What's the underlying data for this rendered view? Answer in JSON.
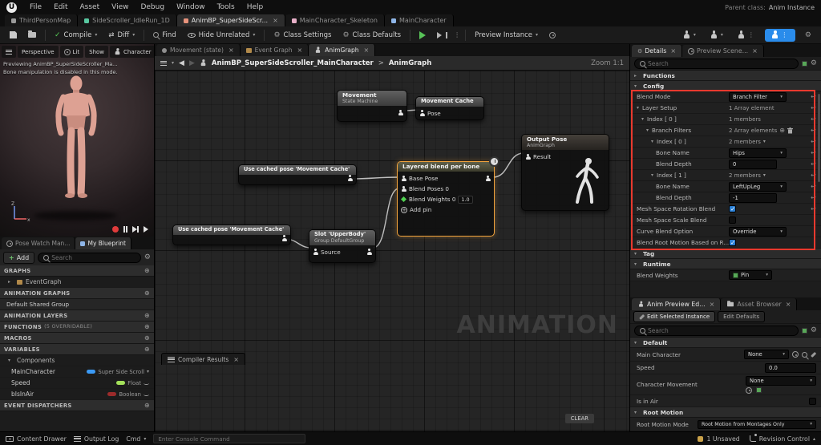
{
  "menubar": {
    "items": [
      "File",
      "Edit",
      "Asset",
      "View",
      "Debug",
      "Window",
      "Tools",
      "Help"
    ],
    "parent_class_label": "Parent class:",
    "parent_class_value": "Anim Instance"
  },
  "doc_tabs": [
    {
      "label": "ThirdPersonMap"
    },
    {
      "label": "SideScroller_IdleRun_1D"
    },
    {
      "label": "AnimBP_SuperSideScr..."
    },
    {
      "label": "MainCharacter_Skeleton"
    },
    {
      "label": "MainCharacter"
    }
  ],
  "toolbar": {
    "compile_label": "Compile",
    "diff_label": "Diff",
    "find_label": "Find",
    "hide_unrelated_label": "Hide Unrelated",
    "class_settings_label": "Class Settings",
    "class_defaults_label": "Class Defaults",
    "preview_instance_label": "Preview Instance"
  },
  "viewport": {
    "perspective_label": "Perspective",
    "lit_label": "Lit",
    "show_label": "Show",
    "character_label": "Character",
    "overlay_line1": "Previewing AnimBP_SuperSideScroller_Ma...",
    "overlay_line2": "Bone manipulation is disabled in this mode.",
    "axis_z": "Z",
    "axis_x": "x"
  },
  "my_blueprint": {
    "tab_pose_watch": "Pose Watch Man...",
    "tab_my_blueprint": "My Blueprint",
    "add_label": "Add",
    "search_placeholder": "Search",
    "graphs_header": "GRAPHS",
    "event_graph_item": "EventGraph",
    "animation_graphs_header": "ANIMATION GRAPHS",
    "default_shared_group": "Default Shared Group",
    "animation_layers_header": "ANIMATION LAYERS",
    "functions_header": "FUNCTIONS",
    "functions_note": "(5 OVERRIDABLE)",
    "macros_header": "MACROS",
    "variables_header": "VARIABLES",
    "components_category": "Components",
    "variables": [
      {
        "name": "MainCharacter",
        "type": "Super Side Scroll"
      },
      {
        "name": "Speed",
        "type": "Float"
      },
      {
        "name": "bIsInAir",
        "type": "Boolean"
      }
    ],
    "event_dispatchers_header": "EVENT DISPATCHERS"
  },
  "graph": {
    "tabs": [
      {
        "label": "Movement (state)"
      },
      {
        "label": "Event Graph"
      },
      {
        "label": "AnimGraph"
      }
    ],
    "breadcrumb_root": "AnimBP_SuperSideScroller_MainCharacter",
    "breadcrumb_sep": ">",
    "breadcrumb_current": "AnimGraph",
    "zoom_label": "Zoom 1:1",
    "watermark": "ANIMATION",
    "compiler_results_label": "Compiler Results",
    "clear_label": "CLEAR",
    "nodes": {
      "movement": {
        "title": "Movement",
        "subtitle": "State Machine"
      },
      "movement_cache": {
        "title": "Movement Cache",
        "pin_pose": "Pose"
      },
      "use_cached_pose_1": {
        "title": "Use cached pose 'Movement Cache'"
      },
      "use_cached_pose_2": {
        "title": "Use cached pose 'Movement Cache'"
      },
      "slot": {
        "title": "Slot 'UpperBody'",
        "subtitle": "Group DefaultGroup",
        "pin_source": "Source"
      },
      "layered_blend": {
        "title": "Layered blend per bone",
        "pin_base_pose": "Base Pose",
        "pin_blend_poses": "Blend Poses 0",
        "pin_blend_weights": "Blend Weights 0",
        "blend_weight_value": "1.0",
        "add_pin_label": "Add pin"
      },
      "output_pose": {
        "title": "Output Pose",
        "subtitle": "AnimGraph",
        "pin_result": "Result"
      }
    }
  },
  "details": {
    "tab_details": "Details",
    "tab_preview_scene": "Preview Scene...",
    "search_placeholder": "Search",
    "functions_header": "Functions",
    "config_header": "Config",
    "rows": [
      {
        "label": "Blend Mode",
        "value": "Branch Filter"
      },
      {
        "label": "Layer Setup",
        "value": "1 Array element"
      },
      {
        "label": "Index [ 0 ]",
        "value": "1 members"
      },
      {
        "label": "Branch Filters",
        "value": "2 Array elements"
      },
      {
        "label": "Index [ 0 ]",
        "value": "2 members"
      },
      {
        "label": "Bone Name",
        "value": "Hips"
      },
      {
        "label": "Blend Depth",
        "value": "0"
      },
      {
        "label": "Index [ 1 ]",
        "value": "2 members"
      },
      {
        "label": "Bone Name",
        "value": "LeftUpLeg"
      },
      {
        "label": "Blend Depth",
        "value": "-1"
      },
      {
        "label": "Mesh Space Rotation Blend",
        "checked": true
      },
      {
        "label": "Mesh Space Scale Blend",
        "checked": false
      },
      {
        "label": "Curve Blend Option",
        "value": "Override"
      },
      {
        "label": "Blend Root Motion Based on R...",
        "checked": true
      }
    ],
    "tag_header": "Tag",
    "runtime_header": "Runtime",
    "blend_weights_label": "Blend Weights",
    "blend_weights_value": "Pin"
  },
  "anim_preview": {
    "tab_editor": "Anim Preview Ed...",
    "tab_asset_browser": "Asset Browser",
    "edit_selected_label": "Edit Selected Instance",
    "edit_defaults_label": "Edit Defaults",
    "search_placeholder": "Search",
    "default_header": "Default",
    "main_character_label": "Main Character",
    "main_character_value": "None",
    "speed_label": "Speed",
    "speed_value": "0.0",
    "character_movement_label": "Character Movement",
    "character_movement_value": "None",
    "is_in_air_label": "Is in Air",
    "is_in_air_checked": false,
    "root_motion_header": "Root Motion",
    "root_motion_mode_label": "Root Motion Mode",
    "root_motion_mode_value": "Root Motion from Montages Only"
  },
  "statusbar": {
    "content_drawer_label": "Content Drawer",
    "output_log_label": "Output Log",
    "cmd_label": "Cmd",
    "console_placeholder": "Enter Console Command",
    "unsaved_label": "1 Unsaved",
    "revision_control_label": "Revision Control"
  }
}
